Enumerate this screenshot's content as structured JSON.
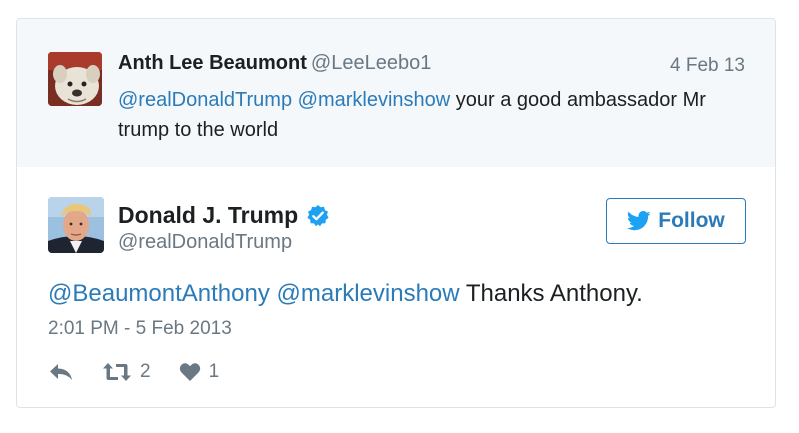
{
  "parent_tweet": {
    "author_name": "Anth Lee Beaumont",
    "author_handle": "@LeeLeebo1",
    "date": "4 Feb 13",
    "mention_1": "@realDonaldTrump",
    "mention_2": "@marklevinshow",
    "text": "your a good ambassador Mr trump to the world",
    "avatar": "bulldog-photo"
  },
  "tweet": {
    "author_name": "Donald J. Trump",
    "author_handle": "@realDonaldTrump",
    "verified_icon": "verified-badge-icon",
    "follow_label": "Follow",
    "mention_1": "@BeaumontAnthony",
    "mention_2": "@marklevinshow",
    "text": "Thanks Anthony.",
    "timestamp": "2:01 PM - 5 Feb 2013",
    "retweet_count": "2",
    "like_count": "1",
    "avatar": "portrait-photo"
  },
  "icons": {
    "reply": "reply-icon",
    "retweet": "retweet-icon",
    "like": "heart-icon",
    "bird": "twitter-bird-icon"
  },
  "colors": {
    "link": "#2b7bb9",
    "verified": "#1da1f2",
    "muted": "#697882",
    "text": "#1c2022",
    "parent_bg": "#f5f8fa",
    "border": "#dfe3e7"
  }
}
